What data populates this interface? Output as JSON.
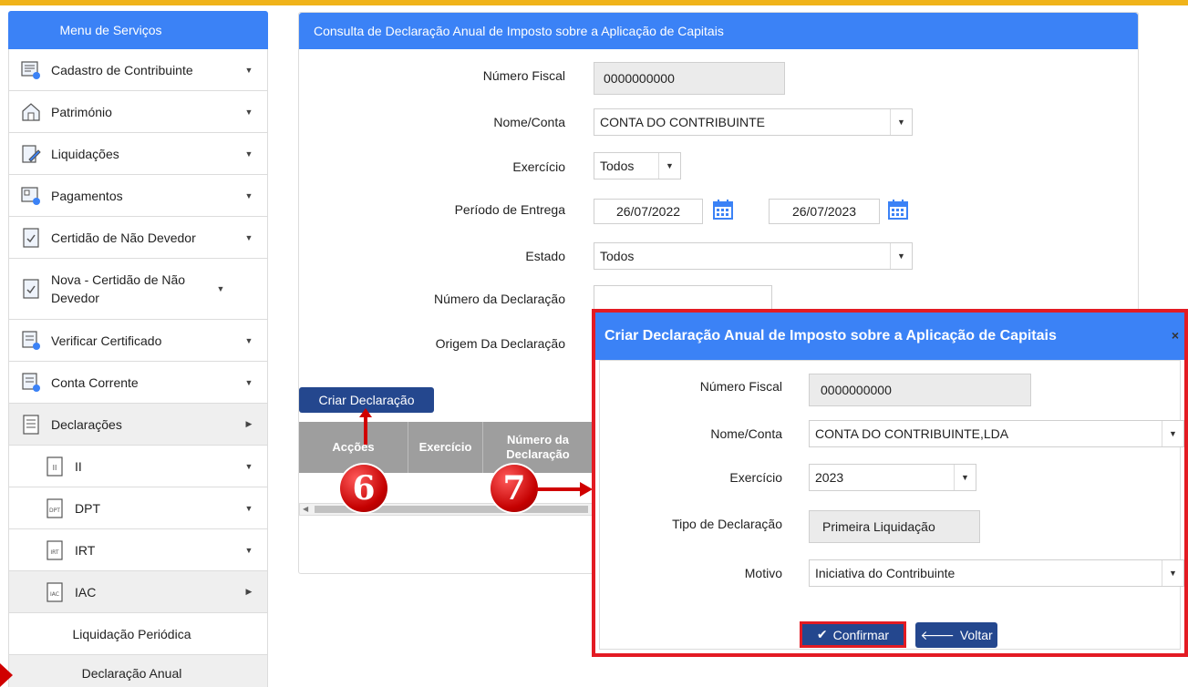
{
  "sidebar": {
    "title": "Menu de Serviços",
    "items": [
      {
        "label": "Cadastro de Contribuinte",
        "icon": "taxpayer-register-icon"
      },
      {
        "label": "Património",
        "icon": "house-icon"
      },
      {
        "label": "Liquidações",
        "icon": "edit-document-icon"
      },
      {
        "label": "Pagamentos",
        "icon": "payment-icon"
      },
      {
        "label": "Certidão de Não Devedor",
        "icon": "certificate-icon"
      },
      {
        "label": "Nova - Certidão de Não Devedor",
        "icon": "certificate-icon"
      },
      {
        "label": "Verificar Certificado",
        "icon": "verify-icon"
      },
      {
        "label": "Conta Corrente",
        "icon": "account-icon"
      },
      {
        "label": "Declarações",
        "icon": "declaration-icon"
      }
    ],
    "sub_items": [
      {
        "label": "II",
        "icon_text": "II"
      },
      {
        "label": "DPT",
        "icon_text": "DPT"
      },
      {
        "label": "IRT",
        "icon_text": "IRT"
      },
      {
        "label": "IAC",
        "icon_text": "IAC"
      }
    ],
    "leaf_items": [
      "Liquidação Periódica",
      "Declaração Anual"
    ]
  },
  "panel": {
    "title": "Consulta de Declaração Anual de Imposto sobre a Aplicação de Capitais",
    "fields": {
      "numero_fiscal_label": "Número Fiscal",
      "numero_fiscal_value": "0000000000",
      "nome_conta_label": "Nome/Conta",
      "nome_conta_value": "CONTA DO CONTRIBUINTE",
      "exercicio_label": "Exercício",
      "exercicio_value": "Todos",
      "periodo_label": "Período de Entrega",
      "periodo_inicio": "26/07/2022",
      "periodo_fim": "26/07/2023",
      "estado_label": "Estado",
      "estado_value": "Todos",
      "numero_declaracao_label": "Número da Declaração",
      "origem_label": "Origem Da Declaração"
    },
    "create_button": "Criar Declaração",
    "table_headers": [
      "Acções",
      "Exercício",
      "Número da Declaração"
    ]
  },
  "callouts": {
    "step6": "6",
    "step7": "7"
  },
  "modal": {
    "title": "Criar Declaração Anual de Imposto sobre a Aplicação de Capitais",
    "close": "×",
    "numero_fiscal_label": "Número Fiscal",
    "numero_fiscal_value": "0000000000",
    "nome_conta_label": "Nome/Conta",
    "nome_conta_value": "CONTA DO CONTRIBUINTE,LDA",
    "exercicio_label": "Exercício",
    "exercicio_value": "2023",
    "tipo_label": "Tipo de Declaração",
    "tipo_value": "Primeira Liquidação",
    "motivo_label": "Motivo",
    "motivo_value": "Iniciativa do Contribuinte",
    "confirm_button": "Confirmar",
    "back_button": "Voltar"
  },
  "colors": {
    "header_blue": "#3b82f6",
    "button_navy": "#24478e",
    "highlight_red": "#e31b23",
    "top_bar": "#f0b31a"
  }
}
